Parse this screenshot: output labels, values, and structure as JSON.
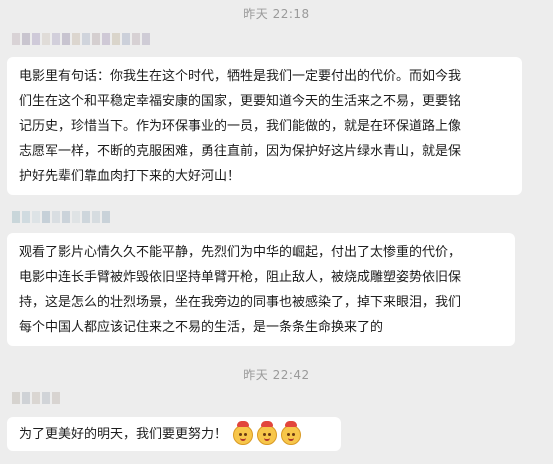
{
  "messages": [
    {
      "type": "timestamp",
      "text": "昨天 22:18"
    },
    {
      "type": "message",
      "text_lines": [
        "电影里有句话：你我生在这个时代，牺牲是我们一定要付出的代价。而如今我",
        "们生在这个和平稳定幸福安康的国家，更要知道今天的生活来之不易，更要铭",
        "记历史，珍惜当下。作为环保事业的一员，我们能做的，就是在环保道路上像",
        "志愿军一样，不断的克服困难，勇往直前，因为保护好这片绿水青山，就是保",
        "护好先辈们靠血肉打下来的大好河山！"
      ]
    },
    {
      "type": "message",
      "text_lines": [
        "观看了影片心情久久不能平静，先烈们为中华的崛起，付出了太惨重的代价，",
        "电影中连长手臂被炸毁依旧坚持单臂开枪，阻止敌人，被烧成雕塑姿势依旧保",
        "持，这是怎么的壮烈场景，坐在我旁边的同事也被感染了，掉下来眼泪，我们",
        "每个中国人都应该记住来之不易的生活，是一条条生命换来了的"
      ]
    },
    {
      "type": "timestamp",
      "text": "昨天 22:42"
    },
    {
      "type": "message",
      "text": "为了更美好的明天，我们要更努力！",
      "emojis": [
        "party-face-icon",
        "party-face-icon",
        "party-face-icon"
      ]
    }
  ],
  "colors": {
    "background": "#ededed",
    "bubble": "#ffffff",
    "timestamp": "#9a9a9a"
  }
}
